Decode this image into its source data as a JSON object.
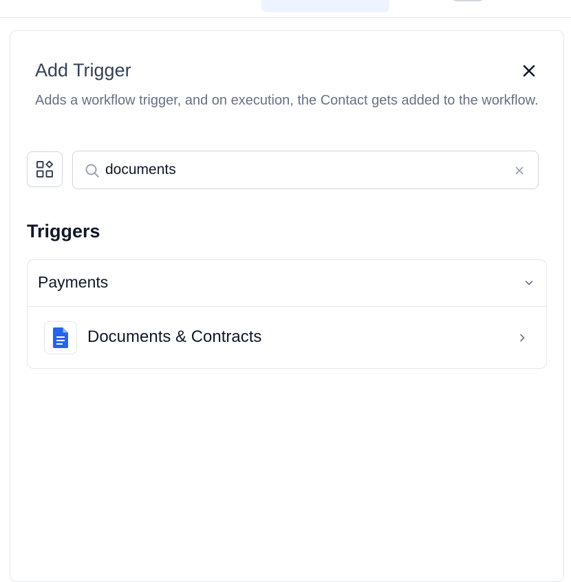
{
  "modal": {
    "title": "Add Trigger",
    "description": "Adds a workflow trigger, and on execution, the Contact gets added to the workflow."
  },
  "search": {
    "value": "documents",
    "placeholder": ""
  },
  "triggers_section": {
    "heading": "Triggers",
    "groups": [
      {
        "label": "Payments",
        "items": [
          {
            "label": "Documents & Contracts",
            "icon": "document-icon"
          }
        ]
      }
    ]
  },
  "icons": {
    "close": "close-icon",
    "filter": "grid-shapes-icon",
    "search": "search-icon",
    "clear": "clear-icon",
    "expand": "chevron-down-icon",
    "open": "chevron-right-icon"
  },
  "colors": {
    "document_icon": "#2563eb",
    "title_text": "#344054",
    "muted_text": "#667085",
    "border": "#e4e7ec",
    "tab_highlight": "#eef4ff"
  }
}
